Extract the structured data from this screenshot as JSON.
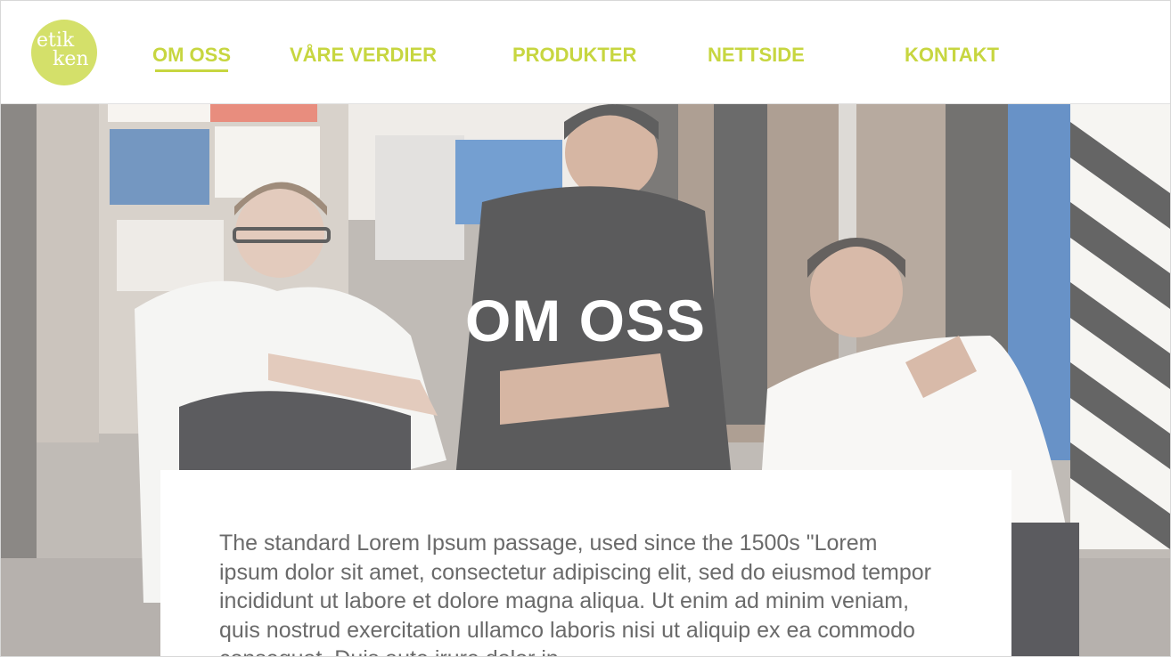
{
  "header": {
    "logo_text": "etikken",
    "nav": [
      {
        "label": "OM OSS",
        "active": true
      },
      {
        "label": "VÅRE VERDIER",
        "active": false
      },
      {
        "label": "PRODUKTER",
        "active": false
      },
      {
        "label": "NETTSIDE",
        "active": false
      },
      {
        "label": "KONTAKT",
        "active": false
      }
    ]
  },
  "hero": {
    "title": "OM OSS"
  },
  "content": {
    "paragraph": "The standard Lorem Ipsum passage, used since the 1500s \"Lorem ipsum dolor sit amet, consectetur adipiscing elit, sed do eiusmod tempor incididunt ut labore et dolore magna aliqua. Ut enim ad minim veniam, quis nostrud exercitation ullamco laboris nisi ut aliquip ex ea commodo consequat. Duis aute irure dolor in"
  },
  "colors": {
    "accent": "#c7d640",
    "logo_bg": "#d4e06a",
    "text": "#6a6a6a"
  }
}
